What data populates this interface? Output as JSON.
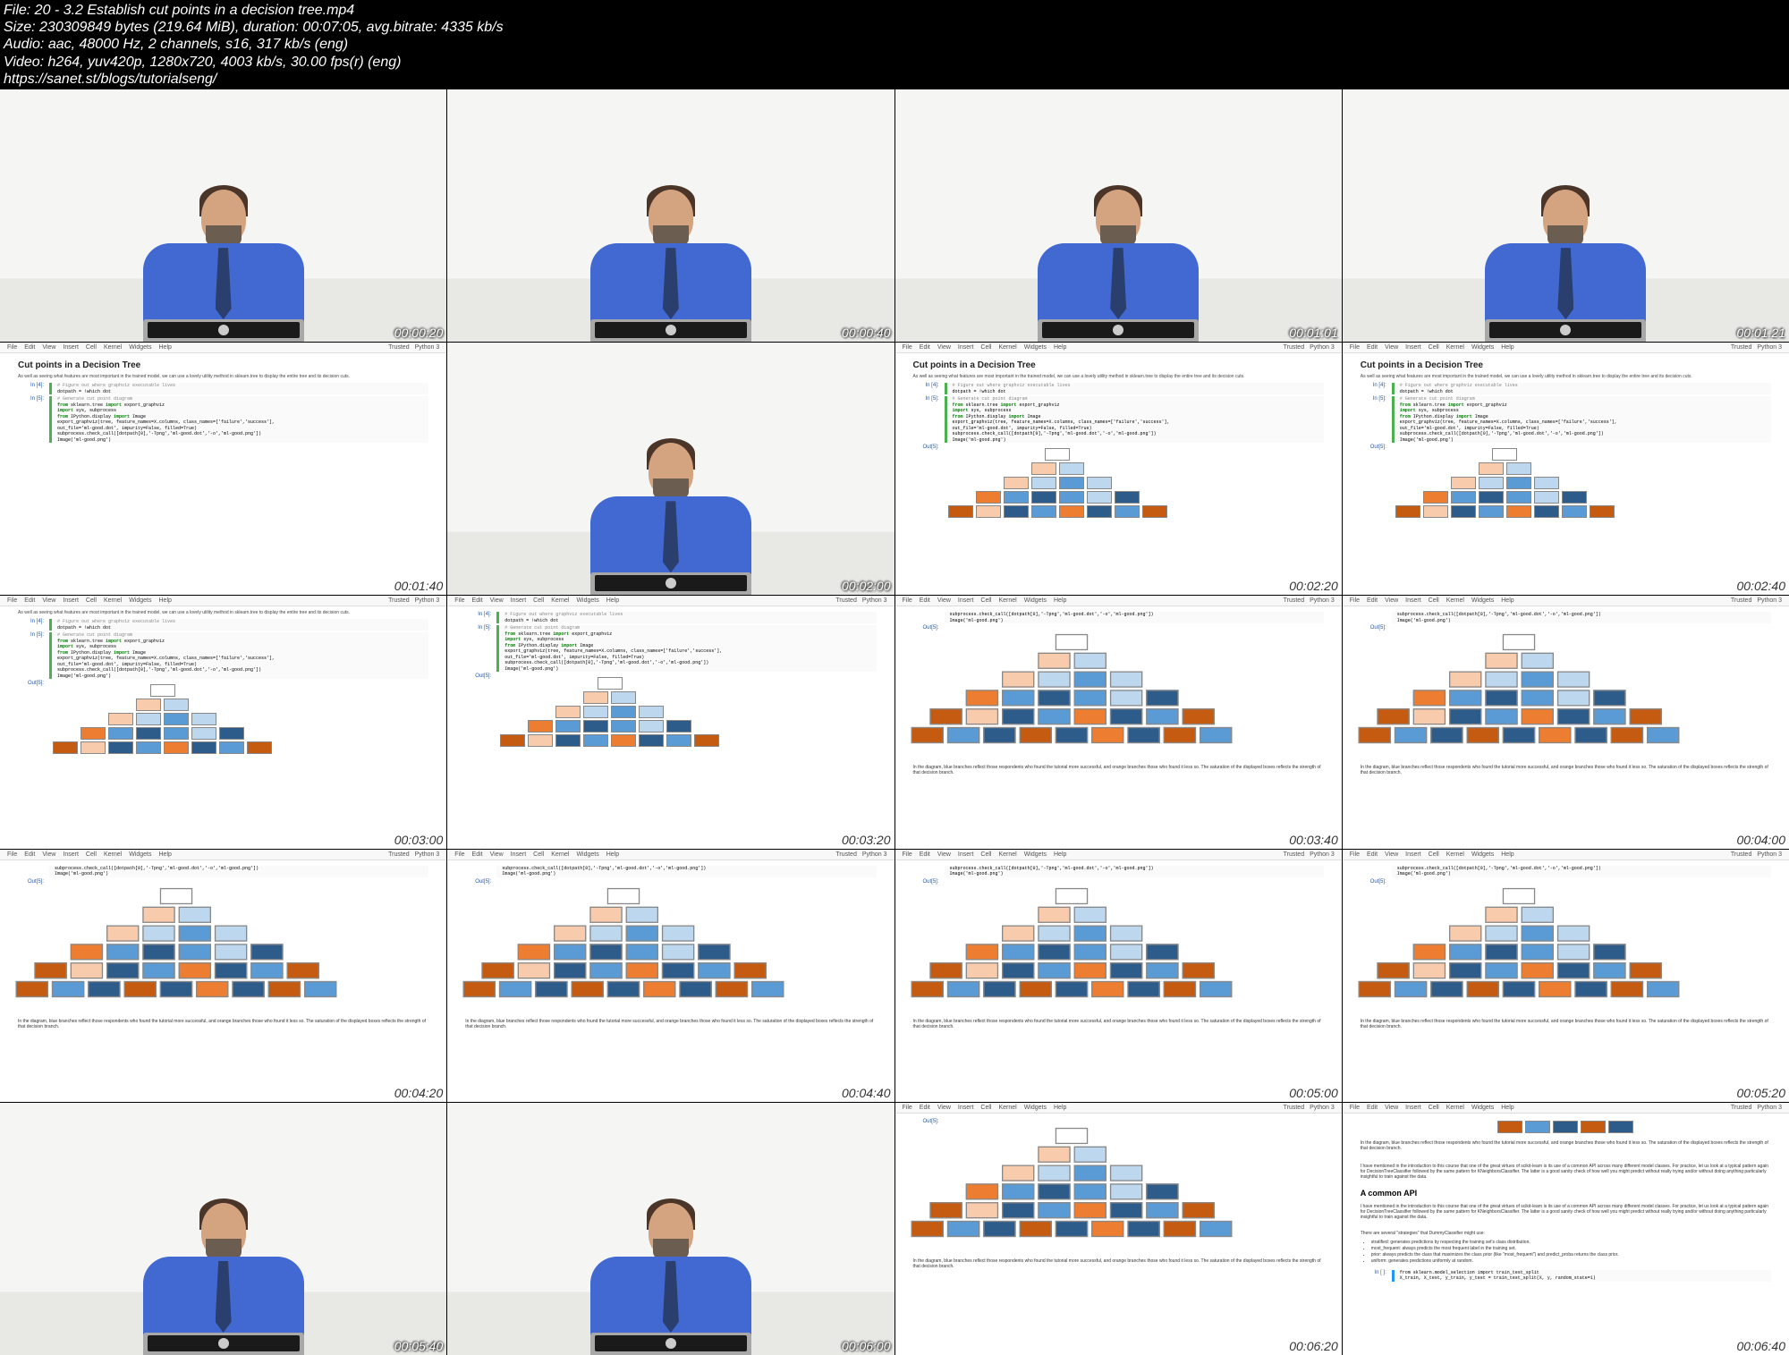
{
  "header": {
    "file": "File: 20 - 3.2 Establish cut points in a decision tree.mp4",
    "size": "Size: 230309849 bytes (219.64 MiB), duration: 00:07:05, avg.bitrate: 4335 kb/s",
    "audio": "Audio: aac, 48000 Hz, 2 channels, s16, 317 kb/s (eng)",
    "video": "Video: h264, yuv420p, 1280x720, 4003 kb/s, 30.00 fps(r) (eng)",
    "url": "https://sanet.st/blogs/tutorialseng/"
  },
  "menu": [
    "File",
    "Edit",
    "View",
    "Insert",
    "Cell",
    "Kernel",
    "Widgets",
    "Help"
  ],
  "menu_right": [
    "Trusted",
    "Python 3"
  ],
  "notebook": {
    "title": "Cut points in a Decision Tree",
    "desc": "As well as seeing what features are most important in the trained model, we can use a lovely utility method in sklearn.tree to display the entire tree and its decision cuts.",
    "prompt1": "In [4]:",
    "code1_c": "# Figure out where graphviz executable lives",
    "code1_l": "dotpath = !which dot",
    "prompt2": "In [5]:",
    "code2_c": "# Generate cut point diagram",
    "code2_l1a": "from",
    "code2_l1b": " sklearn.tree ",
    "code2_l1c": "import",
    "code2_l1d": " export_graphviz",
    "code2_l2a": "import",
    "code2_l2b": " sys, subprocess",
    "code2_l3a": "from",
    "code2_l3b": " IPython.display ",
    "code2_l3c": "import",
    "code2_l3d": " Image",
    "code2_l4": "export_graphviz(tree, feature_names=X.columns, class_names=['failure','success'],",
    "code2_l5": "                out_file='ml-good.dot', impurity=False, filled=True)",
    "code2_l6": "subprocess.check_call([dotpath[0],'-Tpng','ml-good.dot','-o','ml-good.png'])",
    "code2_l7": "Image('ml-good.png')",
    "prompt3": "Out[5]:",
    "caption": "In the diagram, blue branches reflect those respondents who found the tutorial more successful, and orange branches those who found it less so. The saturation of the displayed boxes reflects the strength of that decision branch.",
    "api_title": "A common API",
    "api_text1": "I have mentioned in the introduction to this course that one of the great virtues of scikit-learn is its use of a common API across many different model classes. For practice, let us look at a typical pattern again for DecisionTreeClassifier followed by the same pattern for KNeighborsClassifier. The latter is a good sanity check of how well you might predict without really trying and/or without doing anything particularly insightful to train against the data.",
    "api_text2": "There are several \"strategies\" that DummyClassifier might use:",
    "api_li1": "stratified: generates predictions by respecting the training set's class distribution.",
    "api_li2": "most_frequent: always predicts the most frequent label in the training set.",
    "api_li3": "prior: always predicts the class that maximizes the class prior (like \"most_frequent\") and predict_proba returns the class prior.",
    "api_li4": "uniform: generates predictions uniformly at random.",
    "prompt4": "In [ ]:",
    "code4_l1": "from sklearn.model_selection import train_test_split",
    "code4_l2": "X_train, X_test, y_train, y_test = train_test_split(X, y, random_state=1)"
  },
  "timestamps": [
    "00:00:20",
    "00:00:40",
    "00:01:01",
    "00:01:21",
    "00:01:40",
    "00:02:00",
    "00:02:20",
    "00:02:40",
    "00:03:00",
    "00:03:20",
    "00:03:40",
    "00:04:00",
    "00:04:20",
    "00:04:40",
    "00:05:00",
    "00:05:20",
    "00:05:40",
    "00:06:00",
    "00:06:20",
    "00:06:40"
  ]
}
